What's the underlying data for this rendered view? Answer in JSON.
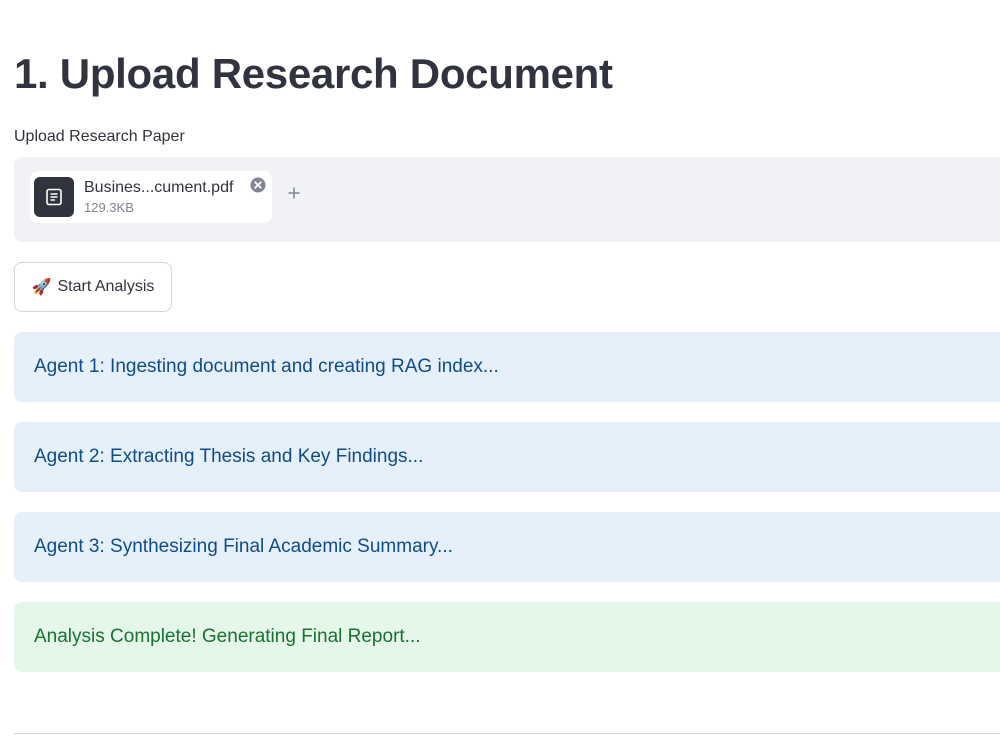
{
  "page_title": "1. Upload Research Document",
  "uploader": {
    "label": "Upload Research Paper",
    "file": {
      "name": "Busines...cument.pdf",
      "size": "129.3KB",
      "icon": "document-icon"
    },
    "remove_icon": "close-circle-icon",
    "add_icon": "plus-icon"
  },
  "start_button": {
    "emoji": "🚀",
    "label": "Start Analysis"
  },
  "status_messages": [
    {
      "kind": "info",
      "text": "Agent 1: Ingesting document and creating RAG index..."
    },
    {
      "kind": "info",
      "text": "Agent 2: Extracting Thesis and Key Findings..."
    },
    {
      "kind": "info",
      "text": "Agent 3: Synthesizing Final Academic Summary..."
    },
    {
      "kind": "success",
      "text": "Analysis Complete! Generating Final Report..."
    }
  ],
  "colors": {
    "info_bg": "#e6f0fb",
    "info_text": "#0f4c8a",
    "success_bg": "#e5f7e9",
    "success_text": "#177233",
    "dropzone_bg": "#f0f2f6"
  }
}
